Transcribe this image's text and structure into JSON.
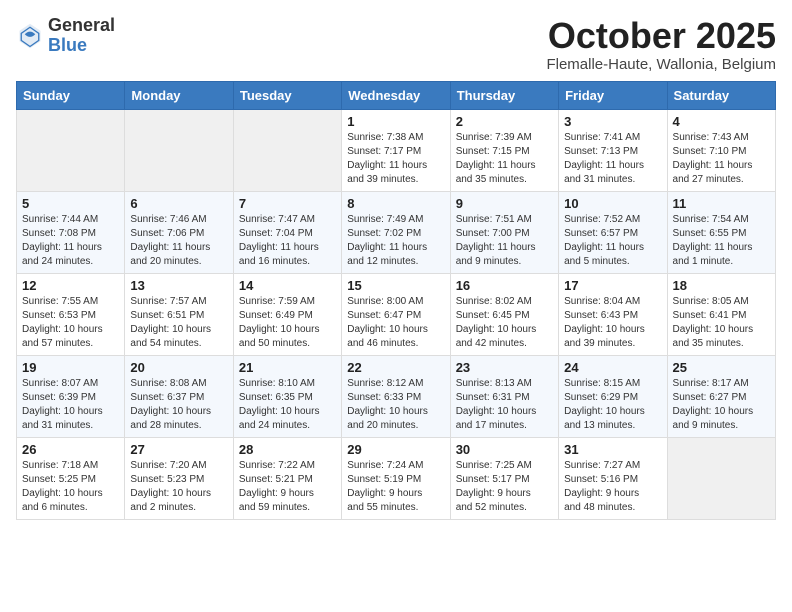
{
  "header": {
    "logo_general": "General",
    "logo_blue": "Blue",
    "month_title": "October 2025",
    "subtitle": "Flemalle-Haute, Wallonia, Belgium"
  },
  "weekdays": [
    "Sunday",
    "Monday",
    "Tuesday",
    "Wednesday",
    "Thursday",
    "Friday",
    "Saturday"
  ],
  "weeks": [
    [
      {
        "day": "",
        "info": ""
      },
      {
        "day": "",
        "info": ""
      },
      {
        "day": "",
        "info": ""
      },
      {
        "day": "1",
        "info": "Sunrise: 7:38 AM\nSunset: 7:17 PM\nDaylight: 11 hours\nand 39 minutes."
      },
      {
        "day": "2",
        "info": "Sunrise: 7:39 AM\nSunset: 7:15 PM\nDaylight: 11 hours\nand 35 minutes."
      },
      {
        "day": "3",
        "info": "Sunrise: 7:41 AM\nSunset: 7:13 PM\nDaylight: 11 hours\nand 31 minutes."
      },
      {
        "day": "4",
        "info": "Sunrise: 7:43 AM\nSunset: 7:10 PM\nDaylight: 11 hours\nand 27 minutes."
      }
    ],
    [
      {
        "day": "5",
        "info": "Sunrise: 7:44 AM\nSunset: 7:08 PM\nDaylight: 11 hours\nand 24 minutes."
      },
      {
        "day": "6",
        "info": "Sunrise: 7:46 AM\nSunset: 7:06 PM\nDaylight: 11 hours\nand 20 minutes."
      },
      {
        "day": "7",
        "info": "Sunrise: 7:47 AM\nSunset: 7:04 PM\nDaylight: 11 hours\nand 16 minutes."
      },
      {
        "day": "8",
        "info": "Sunrise: 7:49 AM\nSunset: 7:02 PM\nDaylight: 11 hours\nand 12 minutes."
      },
      {
        "day": "9",
        "info": "Sunrise: 7:51 AM\nSunset: 7:00 PM\nDaylight: 11 hours\nand 9 minutes."
      },
      {
        "day": "10",
        "info": "Sunrise: 7:52 AM\nSunset: 6:57 PM\nDaylight: 11 hours\nand 5 minutes."
      },
      {
        "day": "11",
        "info": "Sunrise: 7:54 AM\nSunset: 6:55 PM\nDaylight: 11 hours\nand 1 minute."
      }
    ],
    [
      {
        "day": "12",
        "info": "Sunrise: 7:55 AM\nSunset: 6:53 PM\nDaylight: 10 hours\nand 57 minutes."
      },
      {
        "day": "13",
        "info": "Sunrise: 7:57 AM\nSunset: 6:51 PM\nDaylight: 10 hours\nand 54 minutes."
      },
      {
        "day": "14",
        "info": "Sunrise: 7:59 AM\nSunset: 6:49 PM\nDaylight: 10 hours\nand 50 minutes."
      },
      {
        "day": "15",
        "info": "Sunrise: 8:00 AM\nSunset: 6:47 PM\nDaylight: 10 hours\nand 46 minutes."
      },
      {
        "day": "16",
        "info": "Sunrise: 8:02 AM\nSunset: 6:45 PM\nDaylight: 10 hours\nand 42 minutes."
      },
      {
        "day": "17",
        "info": "Sunrise: 8:04 AM\nSunset: 6:43 PM\nDaylight: 10 hours\nand 39 minutes."
      },
      {
        "day": "18",
        "info": "Sunrise: 8:05 AM\nSunset: 6:41 PM\nDaylight: 10 hours\nand 35 minutes."
      }
    ],
    [
      {
        "day": "19",
        "info": "Sunrise: 8:07 AM\nSunset: 6:39 PM\nDaylight: 10 hours\nand 31 minutes."
      },
      {
        "day": "20",
        "info": "Sunrise: 8:08 AM\nSunset: 6:37 PM\nDaylight: 10 hours\nand 28 minutes."
      },
      {
        "day": "21",
        "info": "Sunrise: 8:10 AM\nSunset: 6:35 PM\nDaylight: 10 hours\nand 24 minutes."
      },
      {
        "day": "22",
        "info": "Sunrise: 8:12 AM\nSunset: 6:33 PM\nDaylight: 10 hours\nand 20 minutes."
      },
      {
        "day": "23",
        "info": "Sunrise: 8:13 AM\nSunset: 6:31 PM\nDaylight: 10 hours\nand 17 minutes."
      },
      {
        "day": "24",
        "info": "Sunrise: 8:15 AM\nSunset: 6:29 PM\nDaylight: 10 hours\nand 13 minutes."
      },
      {
        "day": "25",
        "info": "Sunrise: 8:17 AM\nSunset: 6:27 PM\nDaylight: 10 hours\nand 9 minutes."
      }
    ],
    [
      {
        "day": "26",
        "info": "Sunrise: 7:18 AM\nSunset: 5:25 PM\nDaylight: 10 hours\nand 6 minutes."
      },
      {
        "day": "27",
        "info": "Sunrise: 7:20 AM\nSunset: 5:23 PM\nDaylight: 10 hours\nand 2 minutes."
      },
      {
        "day": "28",
        "info": "Sunrise: 7:22 AM\nSunset: 5:21 PM\nDaylight: 9 hours\nand 59 minutes."
      },
      {
        "day": "29",
        "info": "Sunrise: 7:24 AM\nSunset: 5:19 PM\nDaylight: 9 hours\nand 55 minutes."
      },
      {
        "day": "30",
        "info": "Sunrise: 7:25 AM\nSunset: 5:17 PM\nDaylight: 9 hours\nand 52 minutes."
      },
      {
        "day": "31",
        "info": "Sunrise: 7:27 AM\nSunset: 5:16 PM\nDaylight: 9 hours\nand 48 minutes."
      },
      {
        "day": "",
        "info": ""
      }
    ]
  ]
}
